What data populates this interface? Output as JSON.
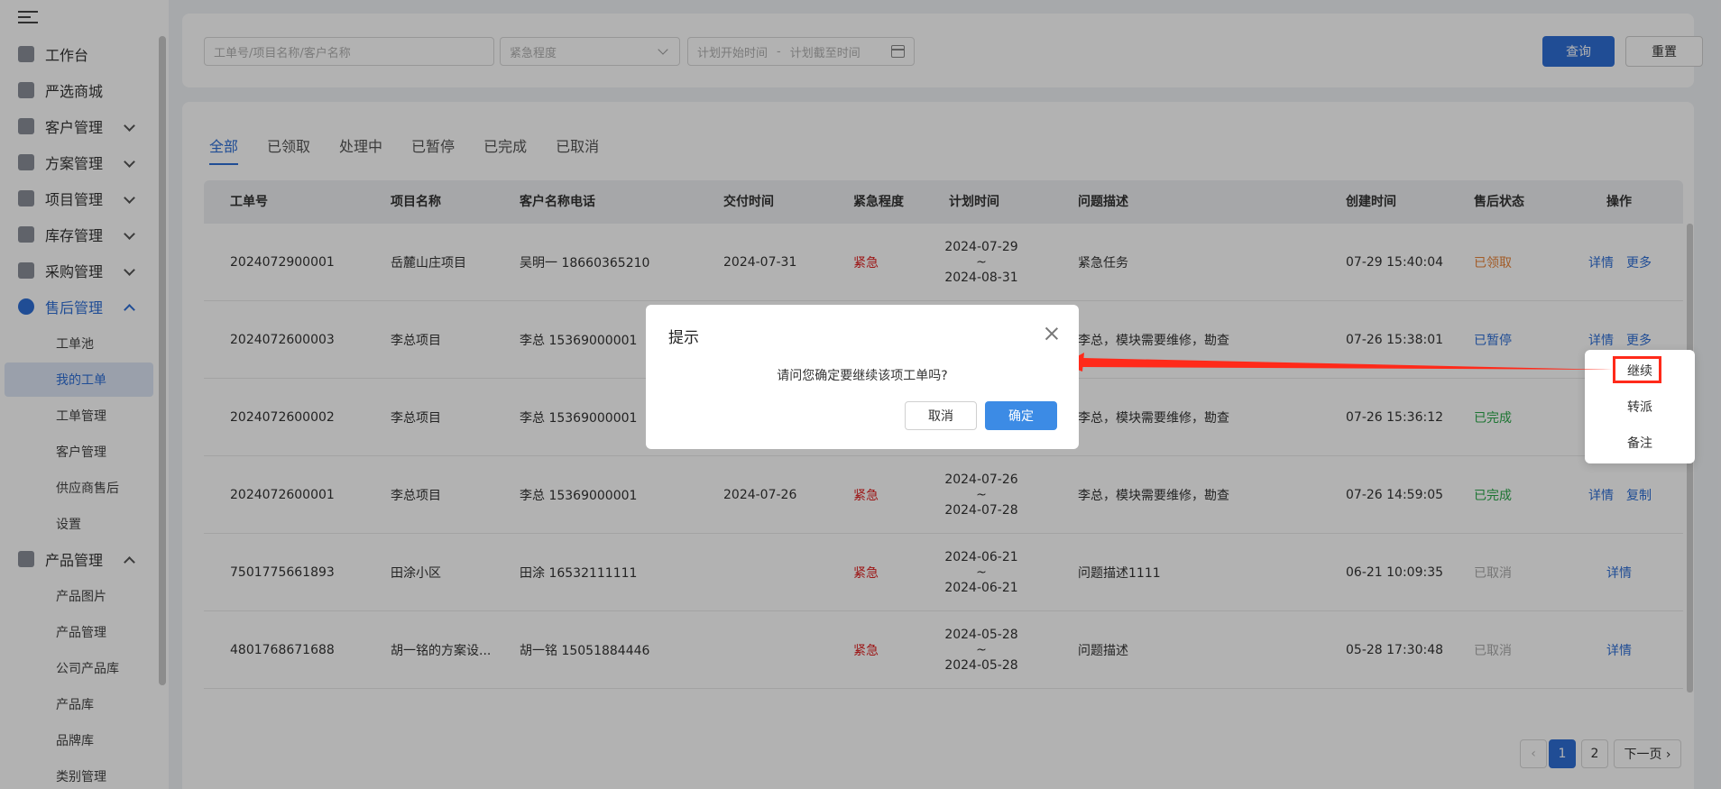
{
  "sidebar": {
    "items": [
      {
        "label": "工作台"
      },
      {
        "label": "严选商城"
      },
      {
        "label": "客户管理"
      },
      {
        "label": "方案管理"
      },
      {
        "label": "项目管理"
      },
      {
        "label": "库存管理"
      },
      {
        "label": "采购管理"
      },
      {
        "label": "售后管理"
      },
      {
        "label": "产品管理"
      }
    ],
    "aftersale_sub": [
      {
        "label": "工单池"
      },
      {
        "label": "我的工单"
      },
      {
        "label": "工单管理"
      },
      {
        "label": "客户管理"
      },
      {
        "label": "供应商售后"
      },
      {
        "label": "设置"
      }
    ],
    "product_sub": [
      {
        "label": "产品图片"
      },
      {
        "label": "产品管理"
      },
      {
        "label": "公司产品库"
      },
      {
        "label": "产品库"
      },
      {
        "label": "品牌库"
      },
      {
        "label": "类别管理"
      }
    ]
  },
  "filters": {
    "keyword_placeholder": "工单号/项目名称/客户名称",
    "urgency_placeholder": "紧急程度",
    "start_placeholder": "计划开始时间",
    "range_sep": "-",
    "end_placeholder": "计划截至时间",
    "query_label": "查询",
    "reset_label": "重置"
  },
  "tabs": [
    "全部",
    "已领取",
    "处理中",
    "已暂停",
    "已完成",
    "已取消"
  ],
  "table": {
    "columns": [
      "工单号",
      "项目名称",
      "客户名称电话",
      "交付时间",
      "紧急程度",
      "计划时间",
      "问题描述",
      "创建时间",
      "售后状态",
      "操作"
    ],
    "rows": [
      {
        "id": "2024072900001",
        "project": "岳麓山庄项目",
        "customer": "吴明一  18660365210",
        "delivery": "2024-07-31",
        "urgency": "紧急",
        "plan_start": "2024-07-29",
        "plan_sep": "~",
        "plan_end": "2024-08-31",
        "desc": "紧急任务",
        "created": "07-29 15:40:04",
        "status": "已领取",
        "action1": "详情",
        "action2": "更多"
      },
      {
        "id": "2024072600003",
        "project": "李总项目",
        "customer": "李总  15369000001",
        "delivery": "",
        "urgency": "",
        "plan_start": "",
        "plan_sep": "",
        "plan_end": "",
        "desc": "李总，模块需要维修，勘查",
        "created": "07-26 15:38:01",
        "status": "已暂停",
        "action1": "详情",
        "action2": "更多"
      },
      {
        "id": "2024072600002",
        "project": "李总项目",
        "customer": "李总  15369000001",
        "delivery": "",
        "urgency": "",
        "plan_start": "",
        "plan_sep": "",
        "plan_end": "",
        "desc": "李总，模块需要维修，勘查",
        "created": "07-26 15:36:12",
        "status": "已完成",
        "action1": "",
        "action2": ""
      },
      {
        "id": "2024072600001",
        "project": "李总项目",
        "customer": "李总  15369000001",
        "delivery": "2024-07-26",
        "urgency": "紧急",
        "plan_start": "2024-07-26",
        "plan_sep": "~",
        "plan_end": "2024-07-28",
        "desc": "李总，模块需要维修，勘查",
        "created": "07-26 14:59:05",
        "status": "已完成",
        "action1": "详情",
        "action2": "复制"
      },
      {
        "id": "7501775661893",
        "project": "田涂小区",
        "customer": "田涂  16532111111",
        "delivery": "",
        "urgency": "紧急",
        "plan_start": "2024-06-21",
        "plan_sep": "~",
        "plan_end": "2024-06-21",
        "desc": "问题描述1111",
        "created": "06-21 10:09:35",
        "status": "已取消",
        "action1": "详情",
        "action2": ""
      },
      {
        "id": "4801768671688",
        "project": "胡一铭的方案设...",
        "customer": "胡一铭  15051884446",
        "delivery": "",
        "urgency": "紧急",
        "plan_start": "2024-05-28",
        "plan_sep": "~",
        "plan_end": "2024-05-28",
        "desc": "问题描述",
        "created": "05-28 17:30:48",
        "status": "已取消",
        "action1": "详情",
        "action2": ""
      }
    ]
  },
  "pagination": {
    "prev": "‹",
    "pages": [
      "1",
      "2"
    ],
    "next": "下一页 ›"
  },
  "dropdown": {
    "items": [
      "继续",
      "转派",
      "备注"
    ]
  },
  "dialog": {
    "title": "提示",
    "message": "请问您确定要继续该项工单吗?",
    "cancel_label": "取消",
    "confirm_label": "确定"
  },
  "colors": {
    "accent": "#2f6fd6",
    "annotation": "#ff2a1a"
  }
}
